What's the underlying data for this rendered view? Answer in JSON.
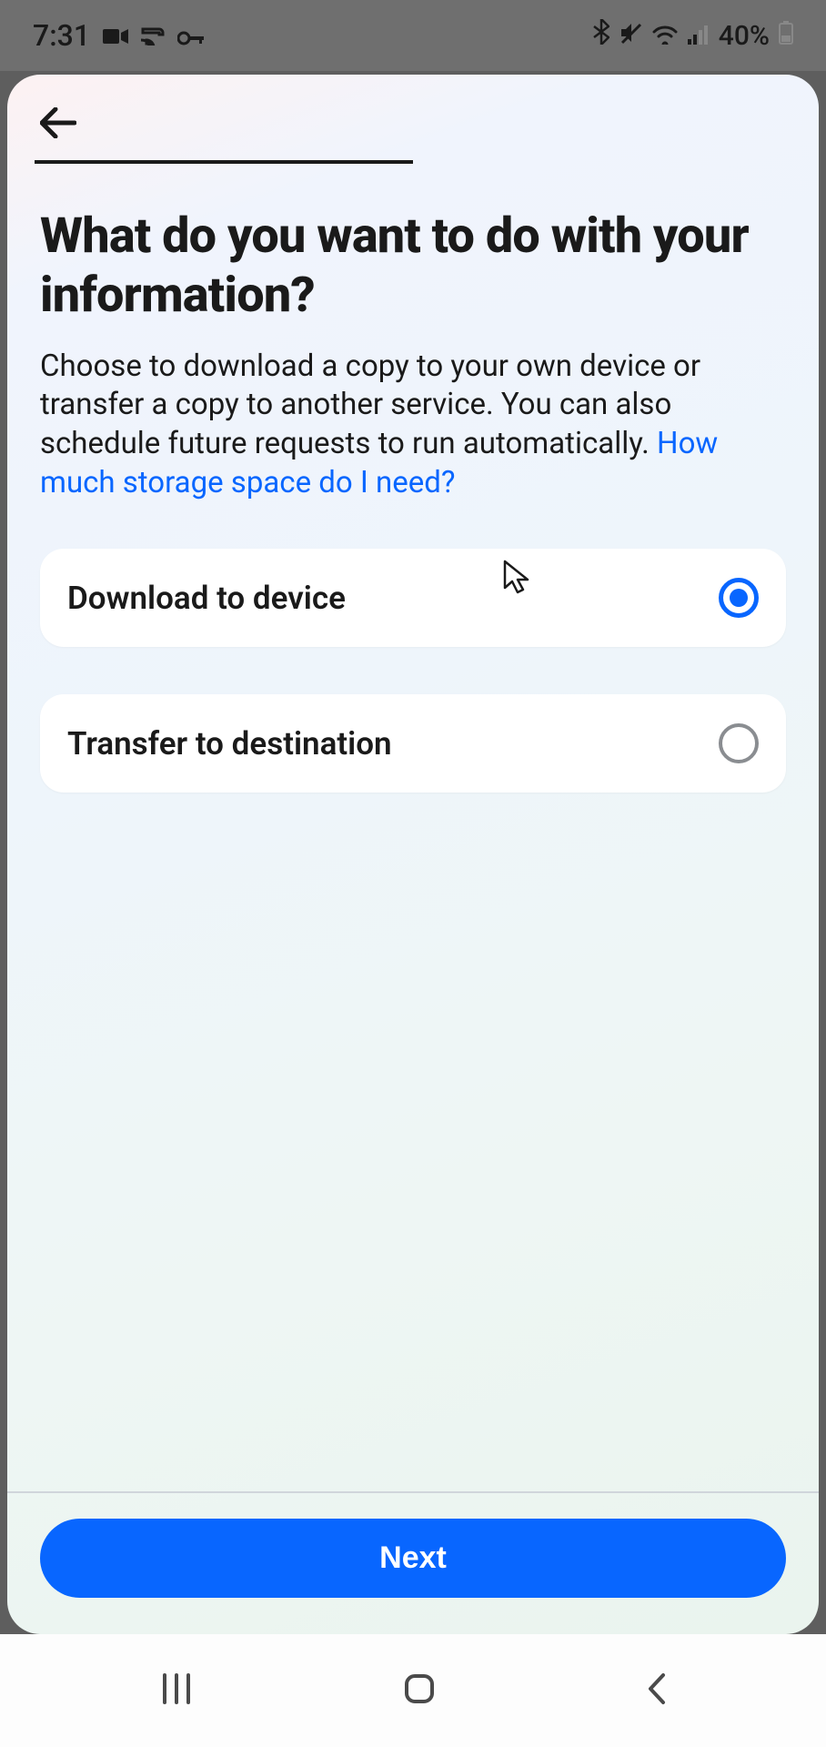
{
  "status_bar": {
    "time": "7:31",
    "battery": "40%"
  },
  "page": {
    "title": "What do you want to do with your information?",
    "description": "Choose to download a copy to your own device or transfer a copy to another service. You can also schedule future requests to run automatically. ",
    "link_text": "How much storage space do I need?"
  },
  "options": [
    {
      "label": "Download to device",
      "selected": true
    },
    {
      "label": "Transfer to destination",
      "selected": false
    }
  ],
  "footer": {
    "next_label": "Next"
  }
}
